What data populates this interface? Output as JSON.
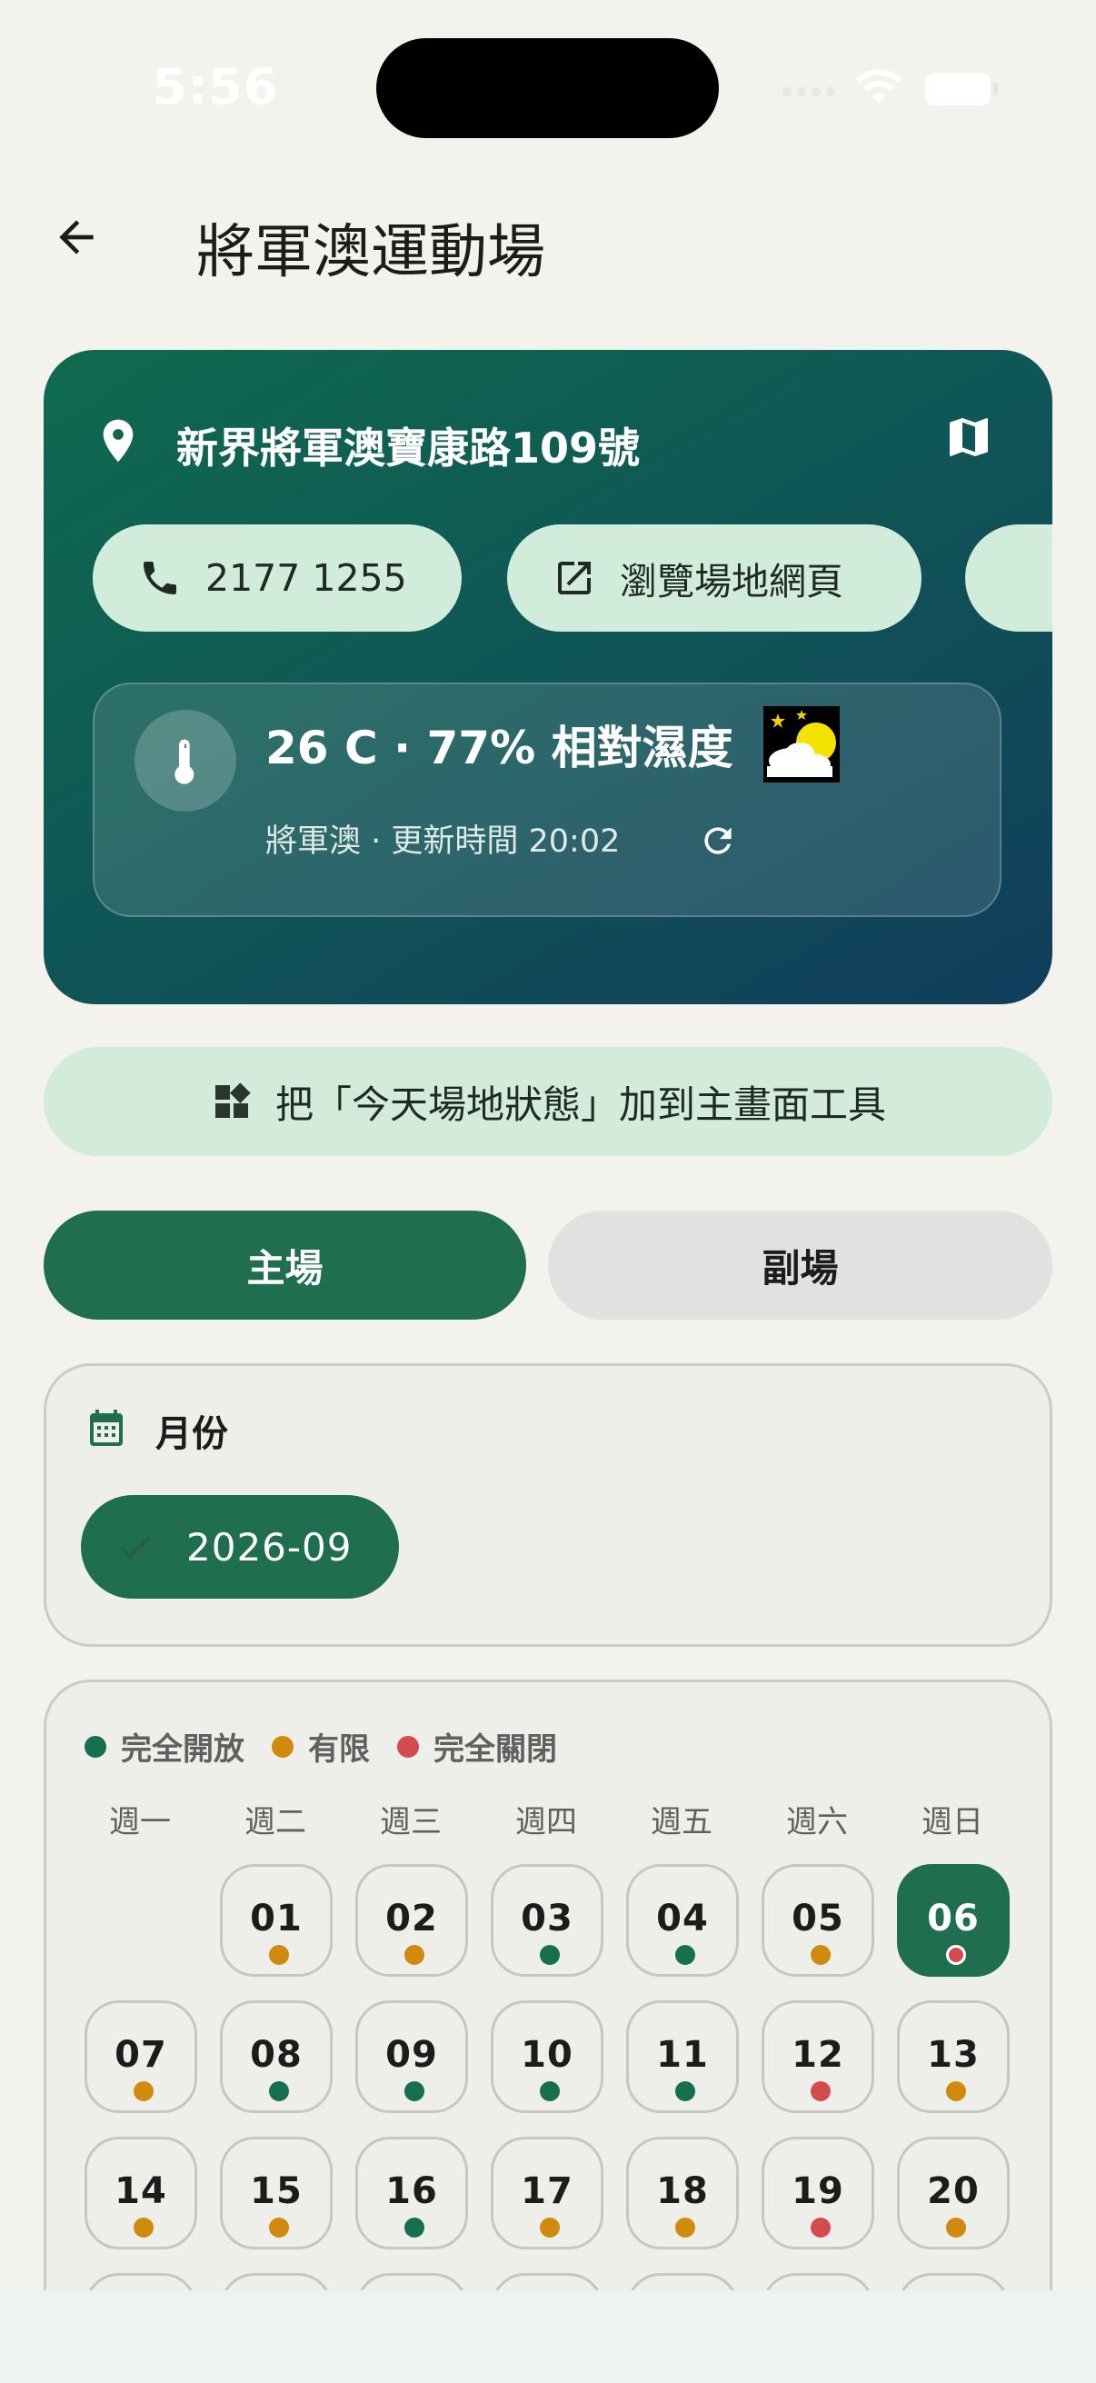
{
  "status_bar": {
    "time": "5:56"
  },
  "header": {
    "title": "將軍澳運動場"
  },
  "venue": {
    "address": "新界將軍澳寶康路109號",
    "phone": "2177 1255",
    "website_label": "瀏覽場地網頁",
    "weather": {
      "summary": "26 C · 77% 相對濕度",
      "detail": "將軍澳 · 更新時間 20:02"
    }
  },
  "widget_button": {
    "label": "把「今天場地狀態」加到主畫面工具"
  },
  "tabs": {
    "main": "主場",
    "sub": "副場"
  },
  "month": {
    "label": "月份",
    "selected": "2026-09"
  },
  "legend": {
    "open": "完全開放",
    "limited": "有限",
    "closed": "完全關閉"
  },
  "colors": {
    "open": "#16704f",
    "limited": "#d08a0c",
    "closed": "#d44b4f",
    "accent": "#1e6e4f"
  },
  "weekdays": [
    "週一",
    "週二",
    "週三",
    "週四",
    "週五",
    "週六",
    "週日"
  ],
  "days": [
    {
      "day": "01",
      "status": "limited"
    },
    {
      "day": "02",
      "status": "limited"
    },
    {
      "day": "03",
      "status": "open"
    },
    {
      "day": "04",
      "status": "open"
    },
    {
      "day": "05",
      "status": "limited"
    },
    {
      "day": "06",
      "status": "closed",
      "selected": true
    },
    {
      "day": "07",
      "status": "limited"
    },
    {
      "day": "08",
      "status": "open"
    },
    {
      "day": "09",
      "status": "open"
    },
    {
      "day": "10",
      "status": "open"
    },
    {
      "day": "11",
      "status": "open"
    },
    {
      "day": "12",
      "status": "closed"
    },
    {
      "day": "13",
      "status": "limited"
    },
    {
      "day": "14",
      "status": "limited"
    },
    {
      "day": "15",
      "status": "limited"
    },
    {
      "day": "16",
      "status": "open"
    },
    {
      "day": "17",
      "status": "limited"
    },
    {
      "day": "18",
      "status": "limited"
    },
    {
      "day": "19",
      "status": "closed"
    },
    {
      "day": "20",
      "status": "limited"
    }
  ]
}
